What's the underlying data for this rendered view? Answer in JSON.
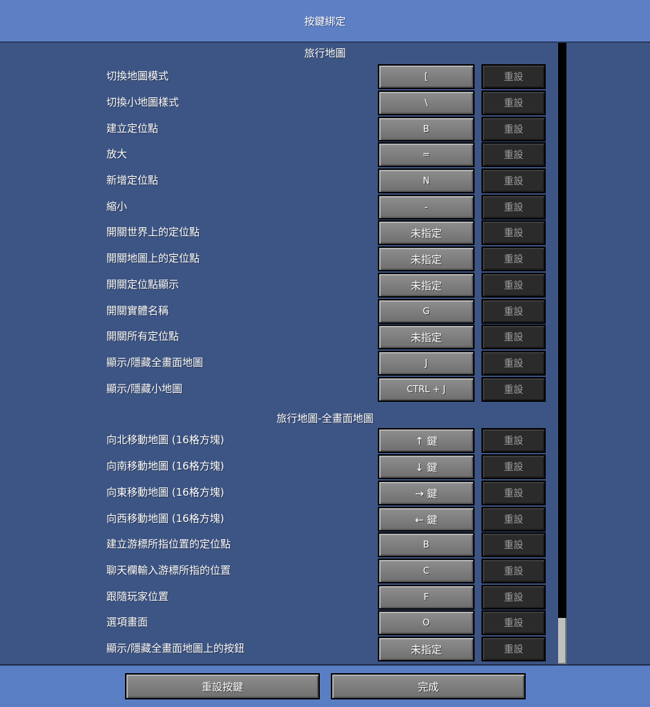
{
  "header": {
    "title": "按鍵綁定"
  },
  "sections": [
    {
      "title": "旅行地圖",
      "rows": [
        {
          "label": "切換地圖模式",
          "key": "[",
          "reset": "重設"
        },
        {
          "label": "切換小地圖樣式",
          "key": "\\",
          "reset": "重設"
        },
        {
          "label": "建立定位點",
          "key": "B",
          "reset": "重設"
        },
        {
          "label": "放大",
          "key": "=",
          "reset": "重設"
        },
        {
          "label": "新增定位點",
          "key": "N",
          "reset": "重設"
        },
        {
          "label": "縮小",
          "key": "-",
          "reset": "重設"
        },
        {
          "label": "開關世界上的定位點",
          "key": "未指定",
          "reset": "重設"
        },
        {
          "label": "開關地圖上的定位點",
          "key": "未指定",
          "reset": "重設"
        },
        {
          "label": "開關定位點顯示",
          "key": "未指定",
          "reset": "重設"
        },
        {
          "label": "開關實體名稱",
          "key": "G",
          "reset": "重設"
        },
        {
          "label": "開關所有定位點",
          "key": "未指定",
          "reset": "重設"
        },
        {
          "label": "顯示/隱藏全畫面地圖",
          "key": "J",
          "reset": "重設"
        },
        {
          "label": "顯示/隱藏小地圖",
          "key": "CTRL + J",
          "reset": "重設"
        }
      ]
    },
    {
      "title": "旅行地圖-全畫面地圖",
      "rows": [
        {
          "label": "向北移動地圖 (16格方塊)",
          "key": "↑ 鍵",
          "reset": "重設"
        },
        {
          "label": "向南移動地圖 (16格方塊)",
          "key": "↓ 鍵",
          "reset": "重設"
        },
        {
          "label": "向東移動地圖 (16格方塊)",
          "key": "→ 鍵",
          "reset": "重設"
        },
        {
          "label": "向西移動地圖 (16格方塊)",
          "key": "← 鍵",
          "reset": "重設"
        },
        {
          "label": "建立游標所指位置的定位點",
          "key": "B",
          "reset": "重設"
        },
        {
          "label": "聊天欄輸入游標所指的位置",
          "key": "C",
          "reset": "重設"
        },
        {
          "label": "跟隨玩家位置",
          "key": "F",
          "reset": "重設"
        },
        {
          "label": "選項畫面",
          "key": "O",
          "reset": "重設"
        },
        {
          "label": "顯示/隱藏全畫面地圖上的按鈕",
          "key": "未指定",
          "reset": "重設"
        }
      ]
    }
  ],
  "footer": {
    "reset_all_label": "重設按鍵",
    "done_label": "完成"
  },
  "colors": {
    "header_bg": "#5d80c5",
    "list_bg": "#3d5584",
    "reset_button_bg": "#2b2b2b",
    "key_button_bg": "#7f7f7f"
  }
}
